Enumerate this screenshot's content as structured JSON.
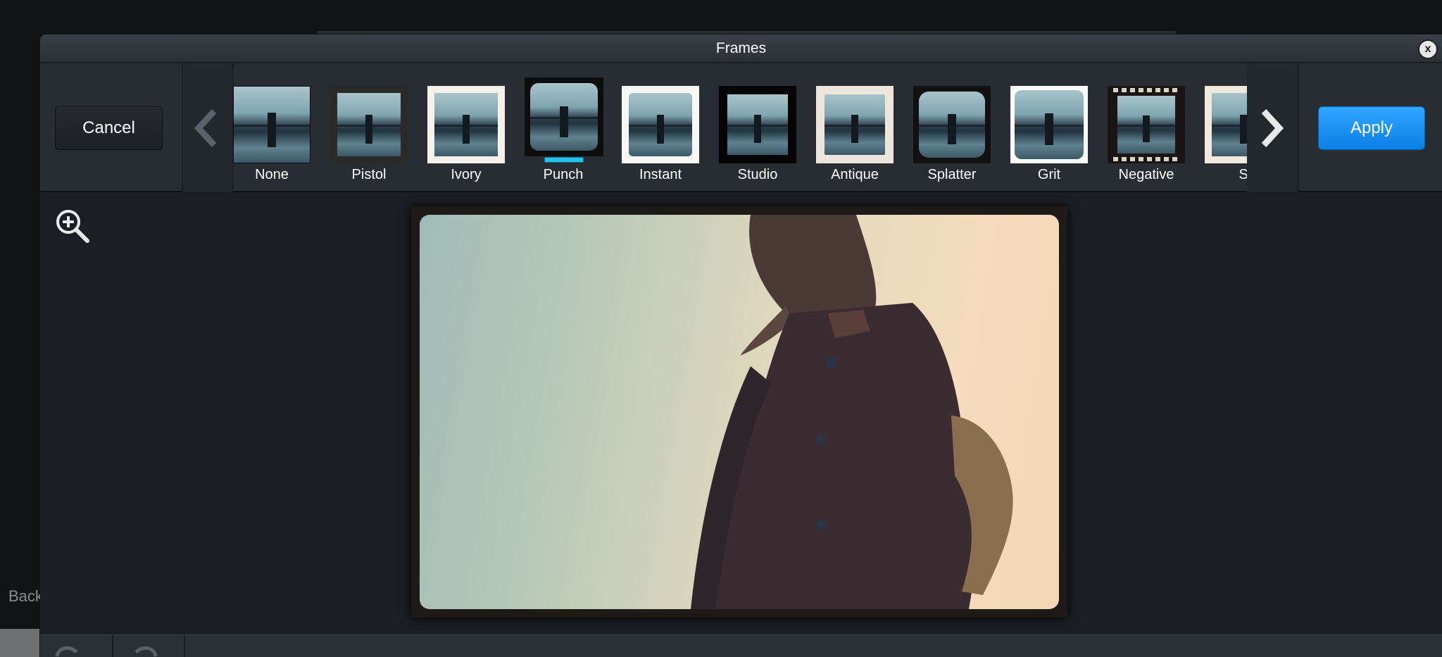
{
  "background": {
    "back_label": "Back"
  },
  "dialog": {
    "title": "Frames",
    "close_label": "x",
    "cancel_label": "Cancel",
    "apply_label": "Apply",
    "accent_color": "#1a90f0",
    "selected_indicator_color": "#27c4ef"
  },
  "frames": [
    {
      "label": "None"
    },
    {
      "label": "Pistol"
    },
    {
      "label": "Ivory"
    },
    {
      "label": "Punch",
      "selected": true
    },
    {
      "label": "Instant"
    },
    {
      "label": "Studio"
    },
    {
      "label": "Antique"
    },
    {
      "label": "Splatter"
    },
    {
      "label": "Grit"
    },
    {
      "label": "Negative"
    },
    {
      "label": "S"
    }
  ],
  "icons": {
    "zoom": "zoom-in-icon",
    "prev": "chevron-left-icon",
    "next": "chevron-right-icon",
    "undo": "undo-icon",
    "redo": "redo-icon"
  }
}
